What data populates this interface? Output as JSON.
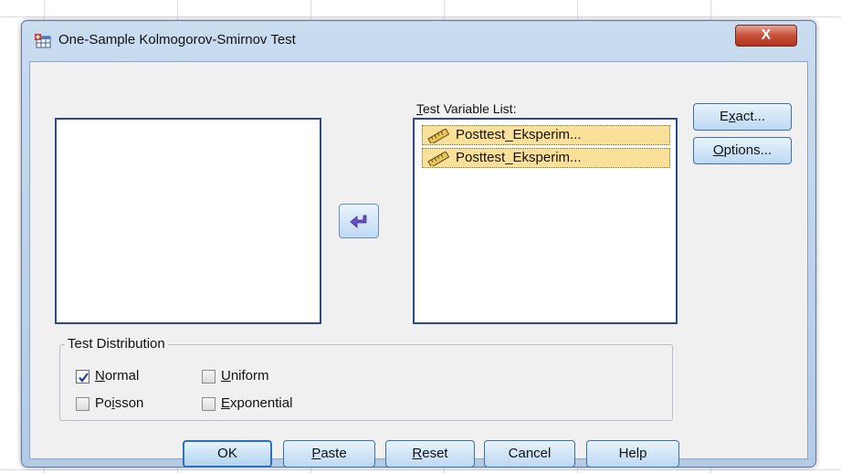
{
  "window": {
    "title": "One-Sample Kolmogorov-Smirnov Test",
    "close_glyph": "X"
  },
  "source_list": {
    "items": []
  },
  "test_variables": {
    "label_underlined": "T",
    "label_rest": "est Variable List:",
    "items": [
      {
        "label": "Posttest_Eksperim...",
        "icon": "scale-ruler-icon"
      },
      {
        "label": "Posttest_Eksperim...",
        "icon": "scale-ruler-icon"
      }
    ]
  },
  "move_button": {
    "icon": "arrow-left-icon"
  },
  "side_buttons": {
    "exact": {
      "pre": "E",
      "underlined": "x",
      "post": "act..."
    },
    "options": {
      "pre": "",
      "underlined": "O",
      "post": "ptions..."
    }
  },
  "test_distribution": {
    "legend": "Test Distribution",
    "options": {
      "normal": {
        "underlined": "N",
        "rest": "ormal",
        "checked": true
      },
      "uniform": {
        "underlined": "U",
        "rest": "niform",
        "checked": false
      },
      "poisson": {
        "pre": "Po",
        "underlined": "i",
        "rest": "sson",
        "checked": false
      },
      "exponential": {
        "underlined": "E",
        "rest": "xponential",
        "checked": false
      }
    }
  },
  "bottom_buttons": {
    "ok": "OK",
    "paste": {
      "underlined": "P",
      "rest": "aste"
    },
    "reset": {
      "underlined": "R",
      "rest": "eset"
    },
    "cancel": "Cancel",
    "help": "Help"
  },
  "colors": {
    "selection": "#fbe09a",
    "list_border": "#2c4a8a",
    "close_button": "#c8503a"
  }
}
